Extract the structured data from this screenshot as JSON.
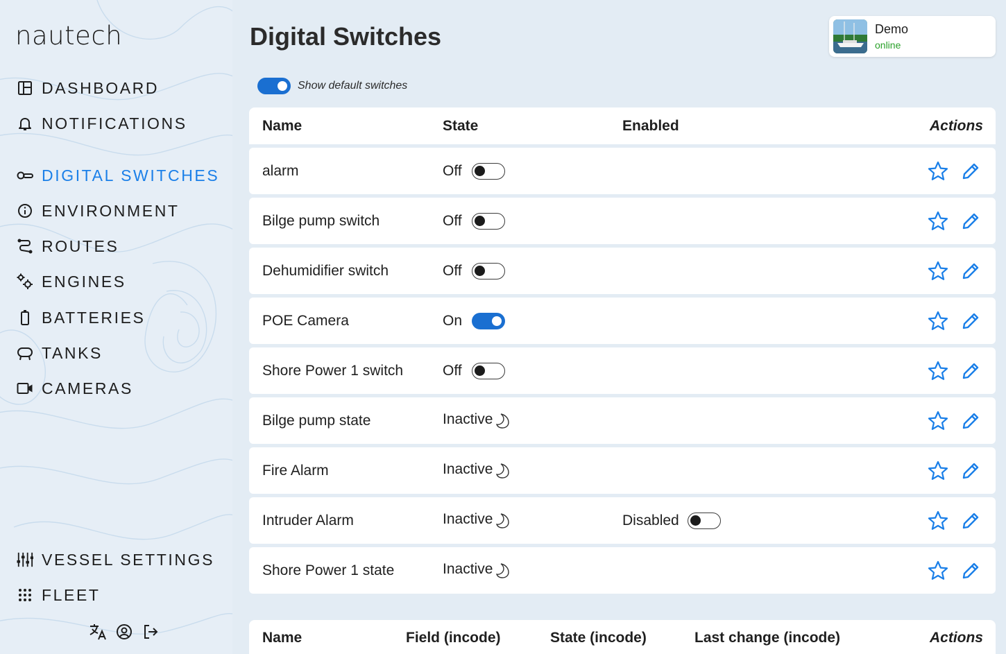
{
  "brand": {
    "logo_text": "nautech"
  },
  "sidebar": {
    "items": [
      {
        "label": "DASHBOARD",
        "icon": "dashboard-icon",
        "active": false
      },
      {
        "label": "NOTIFICATIONS",
        "icon": "bell-icon",
        "active": false
      },
      {
        "label": "DIGITAL SWITCHES",
        "icon": "switch-icon",
        "active": true
      },
      {
        "label": "ENVIRONMENT",
        "icon": "info-icon",
        "active": false
      },
      {
        "label": "ROUTES",
        "icon": "route-icon",
        "active": false
      },
      {
        "label": "ENGINES",
        "icon": "gears-icon",
        "active": false
      },
      {
        "label": "BATTERIES",
        "icon": "battery-icon",
        "active": false
      },
      {
        "label": "TANKS",
        "icon": "tank-icon",
        "active": false
      },
      {
        "label": "CAMERAS",
        "icon": "camera-icon",
        "active": false
      }
    ],
    "bottom_items": [
      {
        "label": "VESSEL SETTINGS",
        "icon": "sliders-icon"
      },
      {
        "label": "FLEET",
        "icon": "grid-dots-icon"
      }
    ],
    "footer_icons": [
      "translate-icon",
      "account-icon",
      "logout-icon"
    ]
  },
  "page": {
    "title": "Digital Switches"
  },
  "vessel": {
    "name": "Demo",
    "status": "online",
    "status_color": "#2aa12a"
  },
  "default_switches": {
    "label": "Show default switches",
    "enabled": true
  },
  "switches_table": {
    "headers": {
      "name": "Name",
      "state": "State",
      "enabled": "Enabled",
      "actions": "Actions"
    },
    "rows": [
      {
        "name": "alarm",
        "state": "Off",
        "kind": "toggle",
        "on": false,
        "enabled_label": ""
      },
      {
        "name": "Bilge pump switch",
        "state": "Off",
        "kind": "toggle",
        "on": false,
        "enabled_label": ""
      },
      {
        "name": "Dehumidifier switch",
        "state": "Off",
        "kind": "toggle",
        "on": false,
        "enabled_label": ""
      },
      {
        "name": "POE Camera",
        "state": "On",
        "kind": "toggle",
        "on": true,
        "enabled_label": ""
      },
      {
        "name": "Shore Power 1 switch",
        "state": "Off",
        "kind": "toggle",
        "on": false,
        "enabled_label": ""
      },
      {
        "name": "Bilge pump state",
        "state": "Inactive",
        "kind": "sensor",
        "on": false,
        "enabled_label": ""
      },
      {
        "name": "Fire Alarm",
        "state": "Inactive",
        "kind": "sensor",
        "on": false,
        "enabled_label": ""
      },
      {
        "name": "Intruder Alarm",
        "state": "Inactive",
        "kind": "sensor",
        "on": false,
        "enabled_label": "Disabled"
      },
      {
        "name": "Shore Power 1 state",
        "state": "Inactive",
        "kind": "sensor",
        "on": false,
        "enabled_label": ""
      }
    ]
  },
  "incode_table": {
    "headers": {
      "name": "Name",
      "field": "Field (incode)",
      "state": "State (incode)",
      "last_change": "Last change (incode)",
      "actions": "Actions"
    }
  },
  "colors": {
    "accent": "#1a7fe8",
    "switch_on": "#1a6fd1",
    "background": "#e3ecf4"
  }
}
